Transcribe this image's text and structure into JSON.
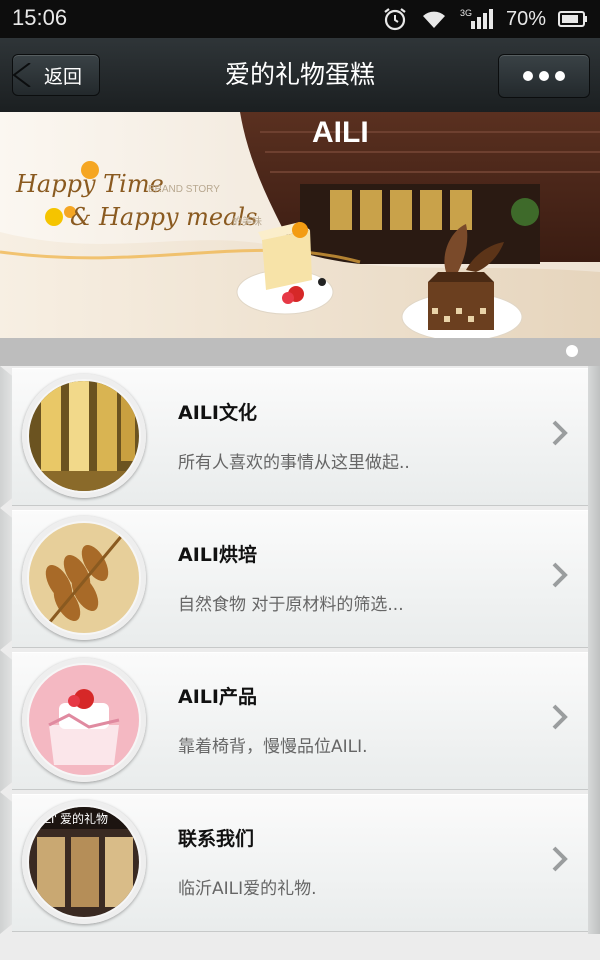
{
  "status_bar": {
    "time": "15:06",
    "network": "3G",
    "battery": "70%"
  },
  "header": {
    "back_label": "返回",
    "title": "爱的礼物蛋糕"
  },
  "banner": {
    "store_sign": "AILI",
    "headline_line1": "Happy Time",
    "headline_line2": "& Happy meals",
    "small_text_1": "BRAND STORY",
    "small_text_2": "的美味",
    "slide_count": 1,
    "active_slide": 1
  },
  "list": {
    "items": [
      {
        "title": "AILI文化",
        "subtitle": "所有人喜欢的事情从这里做起..",
        "thumb": "champagne-glasses"
      },
      {
        "title": "AILI烘培",
        "subtitle": "自然食物 对于原材料的筛选...",
        "thumb": "wheat-ears"
      },
      {
        "title": "AILI产品",
        "subtitle": "靠着椅背，慢慢品位AILI.",
        "thumb": "strawberry-cake"
      },
      {
        "title": "联系我们",
        "subtitle": "临沂AILI爱的礼物.",
        "thumb": "storefront",
        "thumb_sign": "AILI' 爱的礼物"
      }
    ]
  },
  "colors": {
    "header_bg": "#23292c",
    "status_bg": "#0d0d0d",
    "list_bg": "#ececec"
  }
}
